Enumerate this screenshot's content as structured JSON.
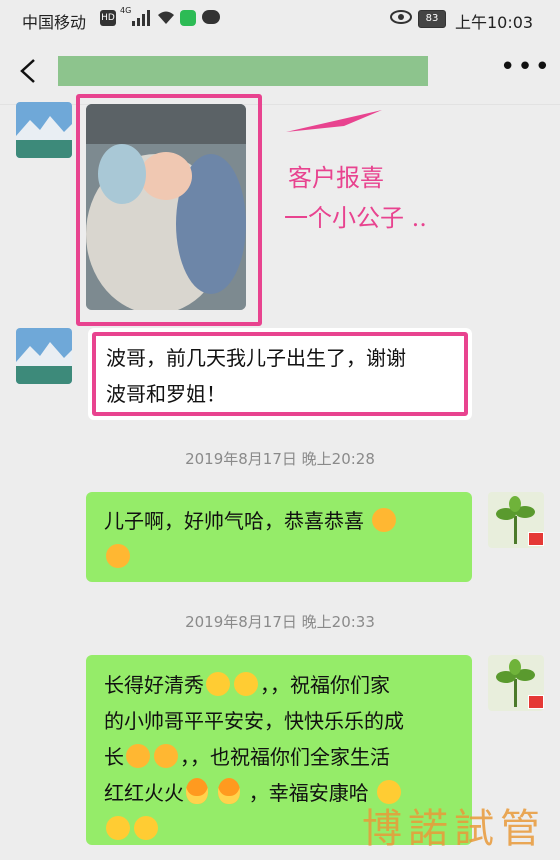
{
  "status_bar": {
    "carrier": "中国移动",
    "hd_label": "HD",
    "network": "4G",
    "battery": "83",
    "time": "上午10:03"
  },
  "nav": {
    "back_icon": "chevron-left-icon",
    "title": "",
    "more_icon": "more-dots-icon"
  },
  "annotation": {
    "line1": "客户报喜",
    "line2": "一个小公子 .."
  },
  "messages": [
    {
      "side": "left",
      "type": "image",
      "content": "photo of a newborn baby wrapped in a blanket"
    },
    {
      "side": "left",
      "type": "text",
      "lines": [
        "波哥，前几天我儿子出生了，谢谢",
        "波哥和罗姐！"
      ]
    },
    {
      "type": "timestamp",
      "text": "2019年8月17日 晚上20:28"
    },
    {
      "side": "right",
      "type": "text",
      "lines": [
        "儿子啊，好帅气哈，恭喜恭喜"
      ]
    },
    {
      "type": "timestamp",
      "text": "2019年8月17日 晚上20:33"
    },
    {
      "side": "right",
      "type": "text",
      "lines": [
        "长得好清秀",
        "，，祝福你们家",
        "的小帅哥平平安安，快快乐乐的成",
        "长",
        "，，也祝福你们全家生活",
        "红红火火",
        "，幸福安康哈"
      ]
    }
  ],
  "watermark": "博諾試管",
  "colors": {
    "accent_pink": "#e8438f",
    "bubble_green": "#95ec69",
    "background": "#ededed"
  }
}
